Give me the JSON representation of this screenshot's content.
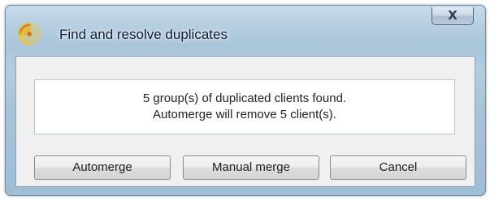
{
  "window": {
    "title": "Find and resolve duplicates",
    "close_label": "X"
  },
  "message": {
    "line1": "5 group(s) of duplicated clients found.",
    "line2": "Automerge will remove 5 client(s)."
  },
  "buttons": {
    "automerge_label": "Automerge",
    "manual_merge_label": "Manual merge",
    "cancel_label": "Cancel"
  },
  "icons": {
    "app_icon": "sound-waves-icon",
    "close_icon": "close-icon"
  },
  "colors": {
    "icon_orange": "#e08a10",
    "icon_yellow": "#f5c22b",
    "title_text": "#0b1c33"
  }
}
